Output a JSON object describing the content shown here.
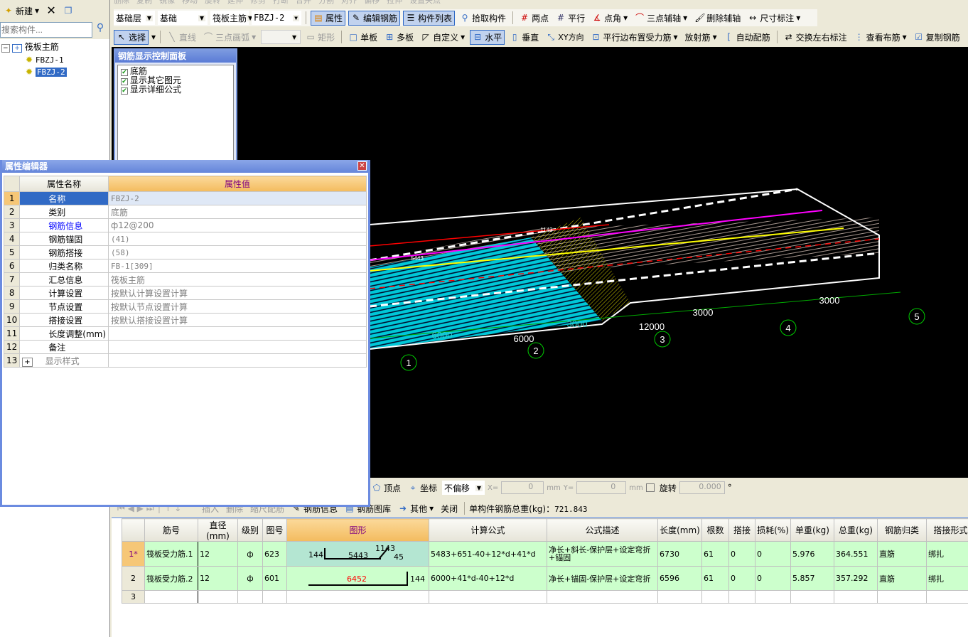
{
  "left_panel": {
    "new_label": "新建",
    "search_placeholder": "搜索构件...",
    "tree": {
      "root": "筏板主筋",
      "children": [
        "FBZJ-1",
        "FBZJ-2"
      ],
      "selected": "FBZJ-2"
    }
  },
  "toolbar_top_faded": [
    "删除",
    "复制",
    "镜像",
    "移动",
    "旋转",
    "延伸",
    "修剪",
    "打断",
    "合并",
    "分割",
    "对齐",
    "偏移",
    "拉伸",
    "设置夹点"
  ],
  "toolbar2": {
    "floor": "基础层",
    "category": "基础",
    "type": "筏板主筋",
    "component": "FBZJ-2",
    "buttons": [
      "属性",
      "编辑钢筋",
      "构件列表",
      "拾取构件",
      "两点",
      "平行",
      "点角",
      "三点辅轴",
      "删除辅轴",
      "尺寸标注"
    ]
  },
  "toolbar3": {
    "select": "选择",
    "buttons": [
      "直线",
      "三点画弧",
      "矩形",
      "单板",
      "多板",
      "自定义",
      "水平",
      "垂直",
      "XY方向",
      "平行边布置受力筋",
      "放射筋",
      "自动配筋",
      "交换左右标注",
      "查看布筋",
      "复制钢筋"
    ]
  },
  "rebar_panel": {
    "title": "钢筋显示控制面板",
    "items": [
      {
        "label": "底筋",
        "checked": true
      },
      {
        "label": "显示其它图元",
        "checked": true
      },
      {
        "label": "显示详细公式",
        "checked": true
      }
    ]
  },
  "property_editor": {
    "title": "属性编辑器",
    "headers": [
      "属性名称",
      "属性值"
    ],
    "rows": [
      {
        "n": "1",
        "name": "名称",
        "value": "FBZJ-2"
      },
      {
        "n": "2",
        "name": "类别",
        "value": "底筋"
      },
      {
        "n": "3",
        "name": "钢筋信息",
        "value": "ф12@200"
      },
      {
        "n": "4",
        "name": "钢筋锚固",
        "value": "(41)"
      },
      {
        "n": "5",
        "name": "钢筋搭接",
        "value": "(58)"
      },
      {
        "n": "6",
        "name": "归类名称",
        "value": "FB-1[309]"
      },
      {
        "n": "7",
        "name": "汇总信息",
        "value": "筏板主筋"
      },
      {
        "n": "8",
        "name": "计算设置",
        "value": "按默认计算设置计算"
      },
      {
        "n": "9",
        "name": "节点设置",
        "value": "按默认节点设置计算"
      },
      {
        "n": "10",
        "name": "搭接设置",
        "value": "按默认搭接设置计算"
      },
      {
        "n": "11",
        "name": "长度调整(mm)",
        "value": ""
      },
      {
        "n": "12",
        "name": "备注",
        "value": ""
      },
      {
        "n": "13",
        "name": "显示样式",
        "value": ""
      }
    ]
  },
  "viewport": {
    "dims": [
      "6000",
      "6000",
      "3000",
      "12000",
      "3000",
      "3000",
      "5443",
      "1143"
    ],
    "axes": [
      "1",
      "2",
      "3",
      "4",
      "5"
    ]
  },
  "snap_bar": {
    "vertex": "顶点",
    "coord": "坐标",
    "offset": "不偏移",
    "x_label": "X=",
    "x": "0",
    "y_label": "Y=",
    "y": "0",
    "unit": "mm",
    "rotate": "旋转",
    "angle": "0.000",
    "deg": "°"
  },
  "table_toolbar": {
    "buttons": [
      "插入",
      "删除",
      "缩尺配筋",
      "钢筋信息",
      "钢筋图库",
      "其他",
      "关闭"
    ],
    "total_label": "单构件钢筋总重(kg)：",
    "total": "721.843"
  },
  "rebar_table": {
    "headers": [
      "",
      "筋号",
      "直径(mm)",
      "级别",
      "图号",
      "图形",
      "计算公式",
      "公式描述",
      "长度(mm)",
      "根数",
      "搭接",
      "损耗(%)",
      "单重(kg)",
      "总重(kg)",
      "钢筋归类",
      "搭接形式"
    ],
    "rows": [
      {
        "n": "1*",
        "name": "筏板受力筋.1",
        "dia": "12",
        "grade": "ф",
        "fig": "623",
        "shape": {
          "left": "144",
          "mid": "5443",
          "top": "1143",
          "angle": "45"
        },
        "formula": "5483+651-40+12*d+41*d",
        "desc": "净长+斜长-保护层+设定弯折+锚固",
        "len": "6730",
        "count": "61",
        "lap": "0",
        "loss": "0",
        "unit": "5.976",
        "total": "364.551",
        "cat": "直筋",
        "lapform": "绑扎"
      },
      {
        "n": "2",
        "name": "筏板受力筋.2",
        "dia": "12",
        "grade": "ф",
        "fig": "601",
        "shape": {
          "mid": "6452",
          "right": "144"
        },
        "formula": "6000+41*d-40+12*d",
        "desc": "净长+锚固-保护层+设定弯折",
        "len": "6596",
        "count": "61",
        "lap": "0",
        "loss": "0",
        "unit": "5.857",
        "total": "357.292",
        "cat": "直筋",
        "lapform": "绑扎"
      },
      {
        "n": "3"
      }
    ]
  },
  "colors": {
    "accent": "#316ac5",
    "header_orange": "#f6c777",
    "row_green": "#ccffcc",
    "canvas": "#000000"
  }
}
